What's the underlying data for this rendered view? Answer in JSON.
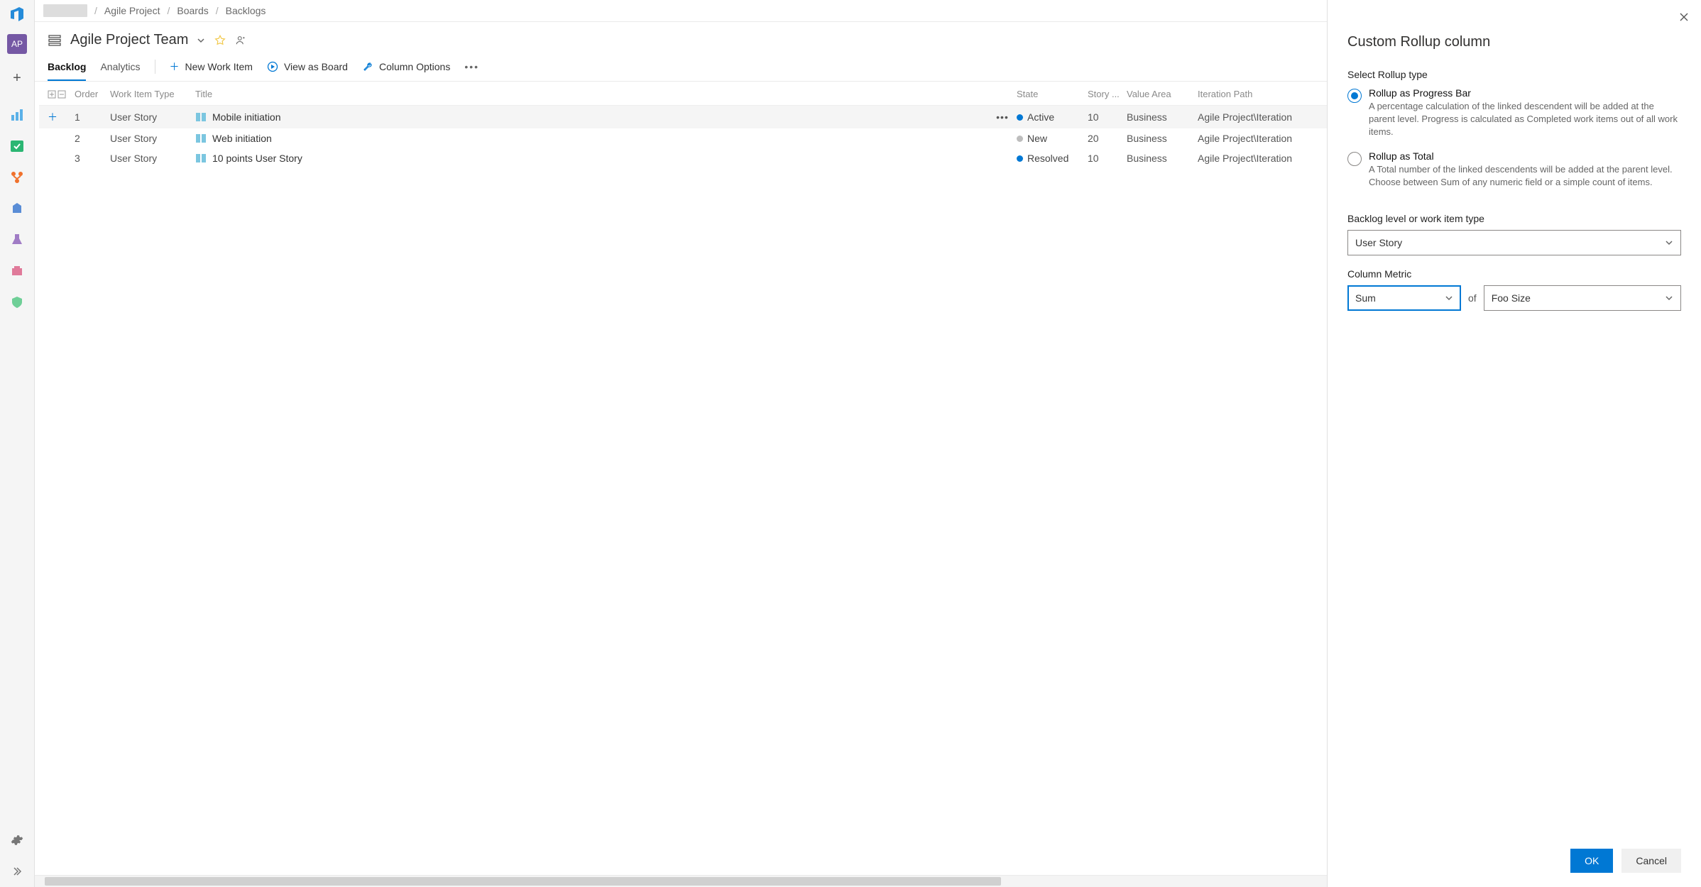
{
  "sidebar": {
    "avatar_text": "AP"
  },
  "breadcrumbs": {
    "items": [
      "Agile Project",
      "Boards",
      "Backlogs"
    ]
  },
  "team": {
    "name": "Agile Project Team"
  },
  "tabs": {
    "backlog": "Backlog",
    "analytics": "Analytics"
  },
  "commands": {
    "new_work_item": "New Work Item",
    "view_as_board": "View as Board",
    "column_options": "Column Options"
  },
  "columns": {
    "order": "Order",
    "work_item_type": "Work Item Type",
    "title": "Title",
    "state": "State",
    "story": "Story ...",
    "value_area": "Value Area",
    "iteration_path": "Iteration Path"
  },
  "rows": [
    {
      "order": "1",
      "type": "User Story",
      "title": "Mobile initiation",
      "state": "Active",
      "state_class": "active",
      "story": "10",
      "value": "Business",
      "iter": "Agile Project\\Iteration",
      "hover": true,
      "show_add": true,
      "show_actions": true
    },
    {
      "order": "2",
      "type": "User Story",
      "title": "Web initiation",
      "state": "New",
      "state_class": "new",
      "story": "20",
      "value": "Business",
      "iter": "Agile Project\\Iteration",
      "hover": false,
      "show_add": false,
      "show_actions": false
    },
    {
      "order": "3",
      "type": "User Story",
      "title": "10 points User Story",
      "state": "Resolved",
      "state_class": "resolved",
      "story": "10",
      "value": "Business",
      "iter": "Agile Project\\Iteration",
      "hover": false,
      "show_add": false,
      "show_actions": false
    }
  ],
  "panel": {
    "title": "Custom Rollup column",
    "select_rollup_label": "Select Rollup type",
    "radio1_title": "Rollup as Progress Bar",
    "radio1_desc": "A percentage calculation of the linked descendent will be added at the parent level. Progress is calculated as Completed work items out of all work items.",
    "radio2_title": "Rollup as Total",
    "radio2_desc": "A Total number of the linked descendents will be added at the parent level. Choose between Sum of any numeric field or a simple count of items.",
    "backlog_level_label": "Backlog level or work item type",
    "backlog_level_value": "User Story",
    "column_metric_label": "Column Metric",
    "metric_value": "Sum",
    "of_label": "of",
    "field_value": "Foo Size",
    "ok": "OK",
    "cancel": "Cancel"
  }
}
